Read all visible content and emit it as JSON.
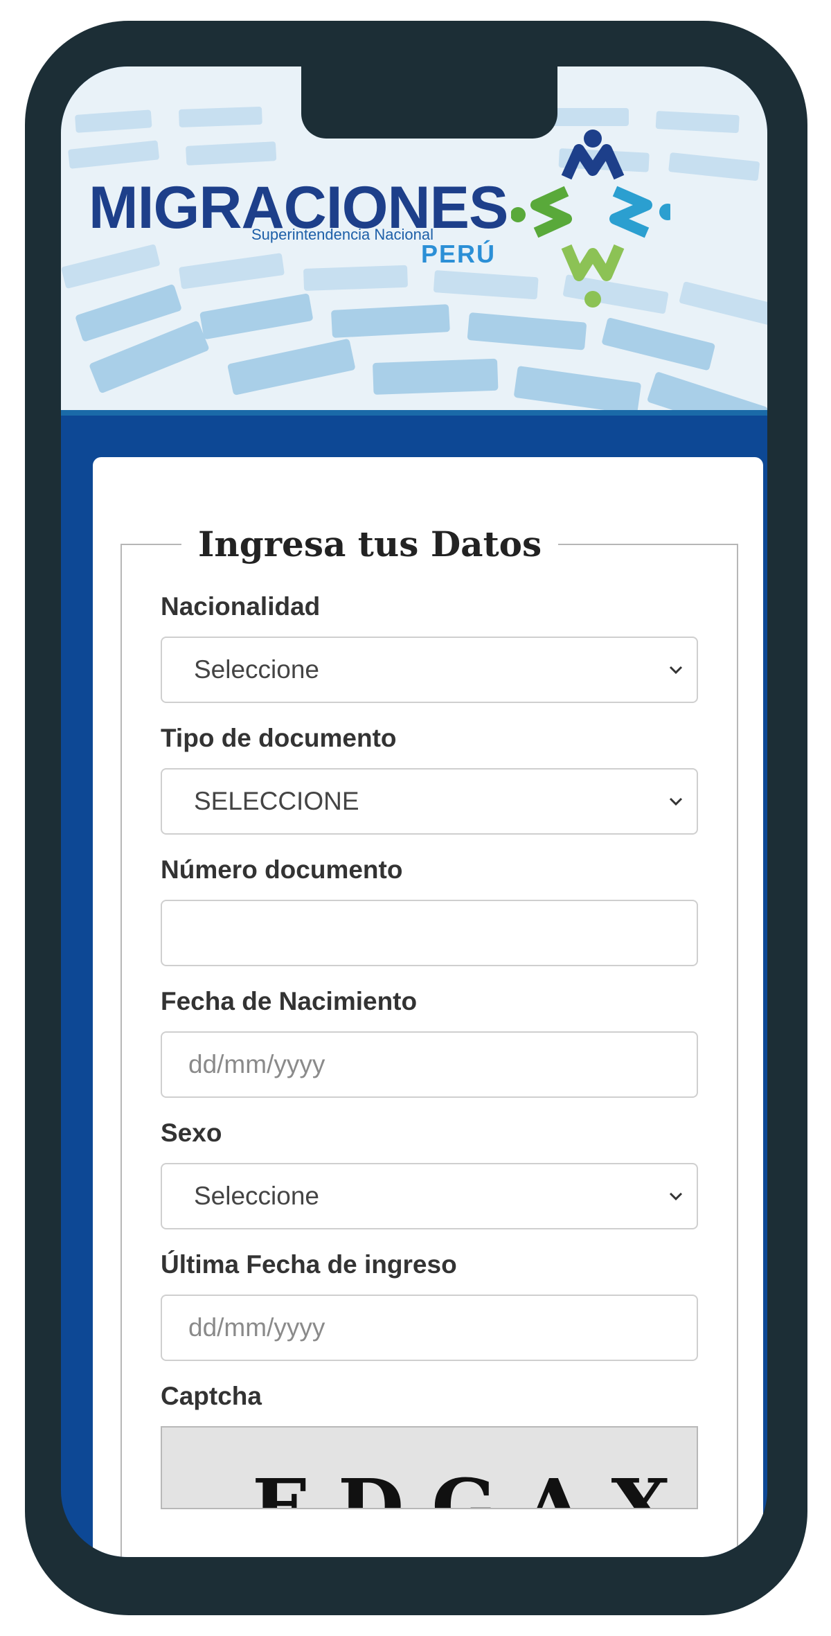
{
  "header": {
    "logo_title": "MIGRACIONES",
    "logo_subtitle": "Superintendencia Nacional",
    "logo_country": "PERÚ"
  },
  "form": {
    "legend": "Ingresa tus Datos",
    "nacionalidad": {
      "label": "Nacionalidad",
      "value": "Seleccione"
    },
    "tipo_documento": {
      "label": "Tipo de documento",
      "value": "SELECCIONE"
    },
    "numero_documento": {
      "label": "Número documento",
      "value": ""
    },
    "fecha_nacimiento": {
      "label": "Fecha de Nacimiento",
      "placeholder": "dd/mm/yyyy"
    },
    "sexo": {
      "label": "Sexo",
      "value": "Seleccione"
    },
    "ultima_fecha_ingreso": {
      "label": "Última Fecha de ingreso",
      "placeholder": "dd/mm/yyyy"
    },
    "captcha": {
      "label": "Captcha",
      "text": "EDGAX"
    }
  },
  "icons": {
    "select_arrow": "chevron-down-icon",
    "logo": "migraciones-logo-icon"
  },
  "colors": {
    "frame": "#1c2e36",
    "brand_blue": "#0d4895",
    "logo_blue": "#1d3f8a",
    "logo_green": "#59a93a",
    "logo_teal": "#2b9fd0"
  }
}
